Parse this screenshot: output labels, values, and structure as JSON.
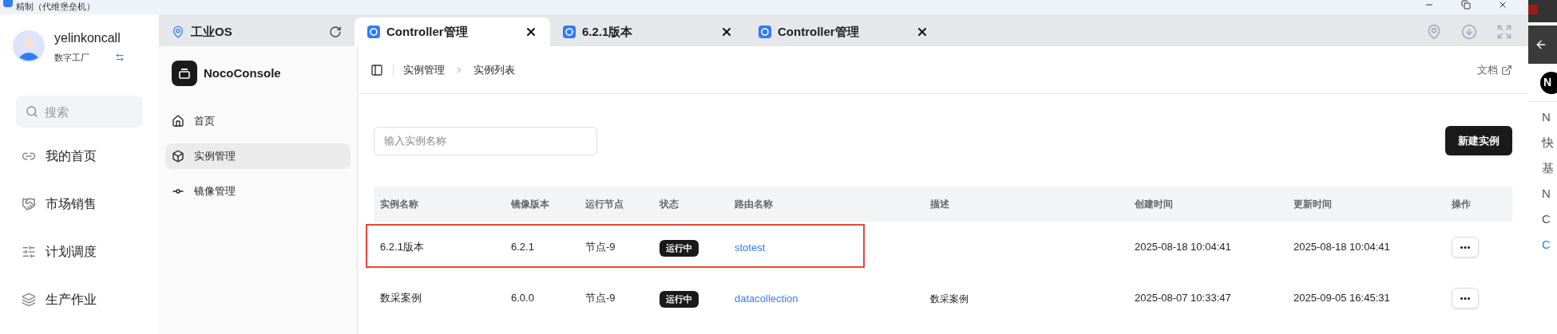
{
  "window": {
    "title": "精制（代维堡垒机）"
  },
  "user": {
    "name": "yelinkoncall",
    "org": "数字工厂"
  },
  "sidebar": {
    "search": {
      "placeholder": "搜索"
    },
    "items": [
      {
        "label": "我的首页"
      },
      {
        "label": "市场销售"
      },
      {
        "label": "计划调度"
      },
      {
        "label": "生产作业"
      }
    ]
  },
  "tabs": [
    {
      "label": "工业OS",
      "kind": "home",
      "selected": false
    },
    {
      "label": "Controller管理",
      "kind": "page",
      "selected": true
    },
    {
      "label": "6.2.1版本",
      "kind": "page",
      "selected": false
    },
    {
      "label": "Controller管理",
      "kind": "page",
      "selected": false
    }
  ],
  "app": {
    "name": "NocoConsole",
    "nav": [
      {
        "label": "首页",
        "selected": false
      },
      {
        "label": "实例管理",
        "selected": true
      },
      {
        "label": "镜像管理",
        "selected": false
      }
    ]
  },
  "breadcrumb": [
    "实例管理",
    "实例列表"
  ],
  "docs_link": "文档",
  "search": {
    "placeholder": "输入实例名称"
  },
  "create_button": "新建实例",
  "table": {
    "columns": [
      "实例名称",
      "镜像版本",
      "运行节点",
      "状态",
      "路由名称",
      "描述",
      "创建时间",
      "更新时间",
      "操作"
    ],
    "rows": [
      {
        "name": "6.2.1版本",
        "version": "6.2.1",
        "node": "节点-9",
        "status": "运行中",
        "route": "stotest",
        "created": "2025-08-18 10:04:41",
        "updated": "2025-08-18 10:04:41",
        "highlighted": true
      },
      {
        "name": "数采案例",
        "version": "6.0.0",
        "node": "节点-9",
        "status": "运行中",
        "route": "datacollection",
        "description": "数采案例",
        "created": "2025-08-07 10:33:47",
        "updated": "2025-09-05 16:45:31",
        "highlighted": false
      }
    ]
  },
  "right_panel": {
    "badge": "N",
    "items": [
      {
        "label": "N",
        "kind": "text"
      },
      {
        "label": "快",
        "kind": "text"
      },
      {
        "label": "基",
        "kind": "text"
      },
      {
        "label": "N",
        "kind": "text"
      },
      {
        "label": "C",
        "kind": "text"
      },
      {
        "label": "C",
        "kind": "link"
      }
    ]
  }
}
